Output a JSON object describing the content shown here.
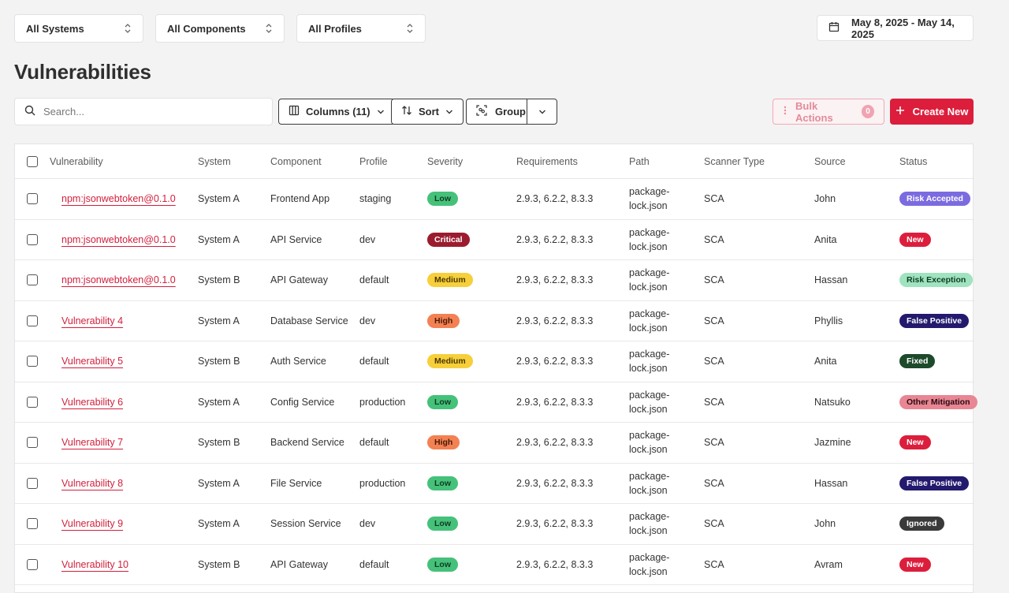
{
  "filters": {
    "systems": "All Systems",
    "components": "All Components",
    "profiles": "All Profiles",
    "date_range": "May 8, 2025 - May 14, 2025"
  },
  "page_title": "Vulnerabilities",
  "toolbar": {
    "search_placeholder": "Search...",
    "columns_label": "Columns (11)",
    "sort_label": "Sort",
    "group_label": "Group",
    "bulk_label": "Bulk Actions",
    "bulk_count": "0",
    "create_label": "Create New"
  },
  "colors": {
    "accent": "#dc1e3c"
  },
  "table": {
    "headers": [
      "Vulnerability",
      "System",
      "Component",
      "Profile",
      "Severity",
      "Requirements",
      "Path",
      "Scanner Type",
      "Source",
      "Status"
    ],
    "rows": [
      {
        "vulnerability": "npm:jsonwebtoken@0.1.0",
        "system": "System A",
        "component": "Frontend App",
        "profile": "staging",
        "severity": "Low",
        "requirements": "2.9.3, 6.2.2, 8.3.3",
        "path": "package-lock.json",
        "scanner": "SCA",
        "source": "John",
        "status": "Risk Accepted"
      },
      {
        "vulnerability": "npm:jsonwebtoken@0.1.0",
        "system": "System A",
        "component": "API Service",
        "profile": "dev",
        "severity": "Critical",
        "requirements": "2.9.3, 6.2.2, 8.3.3",
        "path": "package-lock.json",
        "scanner": "SCA",
        "source": "Anita",
        "status": "New"
      },
      {
        "vulnerability": "npm:jsonwebtoken@0.1.0",
        "system": "System B",
        "component": "API Gateway",
        "profile": "default",
        "severity": "Medium",
        "requirements": "2.9.3, 6.2.2, 8.3.3",
        "path": "package-lock.json",
        "scanner": "SCA",
        "source": "Hassan",
        "status": "Risk Exception"
      },
      {
        "vulnerability": "Vulnerability 4",
        "system": "System A",
        "component": "Database Service",
        "profile": "dev",
        "severity": "High",
        "requirements": "2.9.3, 6.2.2, 8.3.3",
        "path": "package-lock.json",
        "scanner": "SCA",
        "source": "Phyllis",
        "status": "False Positive"
      },
      {
        "vulnerability": "Vulnerability 5",
        "system": "System B",
        "component": "Auth Service",
        "profile": "default",
        "severity": "Medium",
        "requirements": "2.9.3, 6.2.2, 8.3.3",
        "path": "package-lock.json",
        "scanner": "SCA",
        "source": "Anita",
        "status": "Fixed"
      },
      {
        "vulnerability": "Vulnerability 6",
        "system": "System A",
        "component": "Config Service",
        "profile": "production",
        "severity": "Low",
        "requirements": "2.9.3, 6.2.2, 8.3.3",
        "path": "package-lock.json",
        "scanner": "SCA",
        "source": "Natsuko",
        "status": "Other Mitigation"
      },
      {
        "vulnerability": "Vulnerability 7",
        "system": "System B",
        "component": "Backend Service",
        "profile": "default",
        "severity": "High",
        "requirements": "2.9.3, 6.2.2, 8.3.3",
        "path": "package-lock.json",
        "scanner": "SCA",
        "source": "Jazmine",
        "status": "New"
      },
      {
        "vulnerability": "Vulnerability 8",
        "system": "System A",
        "component": "File Service",
        "profile": "production",
        "severity": "Low",
        "requirements": "2.9.3, 6.2.2, 8.3.3",
        "path": "package-lock.json",
        "scanner": "SCA",
        "source": "Hassan",
        "status": "False Positive"
      },
      {
        "vulnerability": "Vulnerability 9",
        "system": "System A",
        "component": "Session Service",
        "profile": "dev",
        "severity": "Low",
        "requirements": "2.9.3, 6.2.2, 8.3.3",
        "path": "package-lock.json",
        "scanner": "SCA",
        "source": "John",
        "status": "Ignored"
      },
      {
        "vulnerability": "Vulnerability 10",
        "system": "System B",
        "component": "API Gateway",
        "profile": "default",
        "severity": "Low",
        "requirements": "2.9.3, 6.2.2, 8.3.3",
        "path": "package-lock.json",
        "scanner": "SCA",
        "source": "Avram",
        "status": "New"
      }
    ]
  },
  "severity_colors": {
    "Low": {
      "bg": "#45c17a",
      "fg": "#0f3b22"
    },
    "Medium": {
      "bg": "#f7cf3b",
      "fg": "#4a3a00"
    },
    "High": {
      "bg": "#f38153",
      "fg": "#4a1a05"
    },
    "Critical": {
      "bg": "#9b1c2e",
      "fg": "#ffffff"
    }
  },
  "status_colors": {
    "Risk Accepted": {
      "bg": "#7b6be0",
      "fg": "#ffffff"
    },
    "New": {
      "bg": "#dc1e3c",
      "fg": "#ffffff"
    },
    "Risk Exception": {
      "bg": "#9fe3bf",
      "fg": "#0f3b22"
    },
    "False Positive": {
      "bg": "#231a6e",
      "fg": "#ffffff"
    },
    "Fixed": {
      "bg": "#1d4a2b",
      "fg": "#ffffff"
    },
    "Other Mitigation": {
      "bg": "#e88694",
      "fg": "#2b0a10"
    },
    "Ignored": {
      "bg": "#3a3a3a",
      "fg": "#ffffff"
    }
  }
}
